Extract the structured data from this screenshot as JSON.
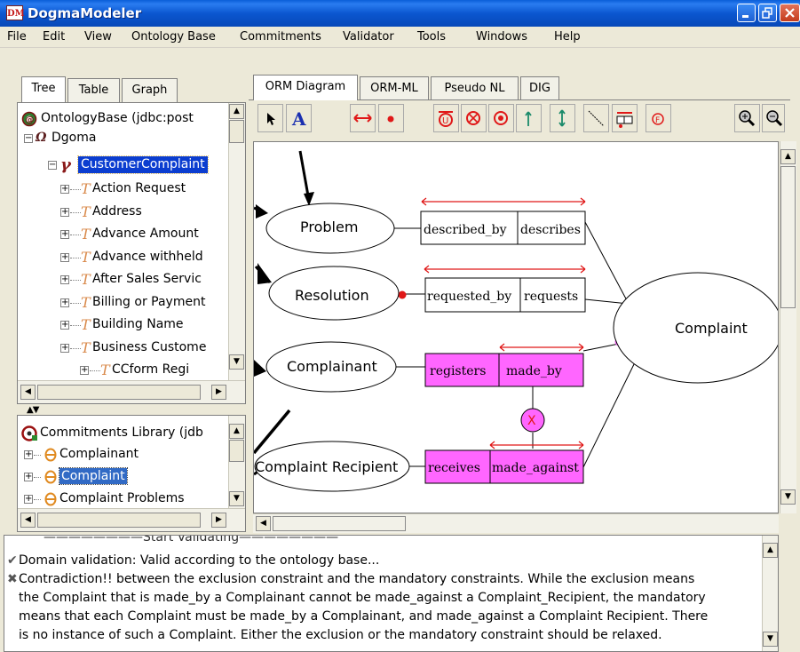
{
  "window": {
    "title": "DogmaModeler",
    "icon_label": "DM"
  },
  "menu": [
    "File",
    "Edit",
    "View",
    "Ontology Base",
    "Commitments",
    "Validator",
    "Tools",
    "Windows",
    "Help"
  ],
  "left_tabs": [
    "Tree",
    "Table",
    "Graph"
  ],
  "ontology_tree": {
    "root": "OntologyBase (jdbc:post",
    "child": "Dgoma",
    "selected": "CustomerComplaint",
    "items": [
      "Action Request",
      "Address",
      "Advance Amount",
      "Advance withheld",
      "After Sales Servic",
      "Billing or Payment",
      "Building Name",
      "Business Custome",
      "CCform Regi"
    ]
  },
  "commitments_tree": {
    "root": "Commitments Library (jdb",
    "items": [
      "Complainant",
      "Complaint",
      "Complaint Problems"
    ],
    "selected": "Complaint"
  },
  "editor_tabs": [
    "ORM Diagram",
    "ORM-ML",
    "Pseudo NL",
    "DIG"
  ],
  "toolbar_icons": [
    "pointer-icon",
    "text-icon",
    "double-arrow-icon",
    "mandatory-dot-icon",
    "uniqueness-icon",
    "exclusion-icon",
    "total-icon",
    "subtype-arrow-icon",
    "double-subtype-icon",
    "line-icon",
    "fact-type-icon",
    "frequency-icon",
    "zoom-in-icon",
    "zoom-out-icon"
  ],
  "diagram": {
    "objects": [
      "Problem",
      "Resolution",
      "Complainant",
      "Complaint Recipient",
      "Complaint"
    ],
    "roles": [
      {
        "left": "described_by",
        "right": "describes"
      },
      {
        "left": "requested_by",
        "right": "requests"
      },
      {
        "left": "registers",
        "right": "made_by"
      },
      {
        "left": "receives",
        "right": "made_against"
      }
    ],
    "exclusion_label": "X",
    "colors": {
      "highlight": "#ff66ff",
      "constraint": "#ff0000",
      "mandatory_pink": "#ee66ee"
    }
  },
  "log": {
    "header": "————————Start Validating————————",
    "lines": [
      {
        "icon": "check-icon",
        "text": "Domain validation: Valid according to the ontology base..."
      },
      {
        "icon": "cross-icon",
        "text": "Contradiction!! between the exclusion constraint and the mandatory constraints.  While the exclusion means"
      },
      {
        "icon": "",
        "text": "the Complaint that is made_by a Complainant cannot be made_against a Complaint_Recipient, the mandatory"
      },
      {
        "icon": "",
        "text": "means that each Complaint must be made_by a Complainant, and made_against a Complaint Recipient. There"
      },
      {
        "icon": "",
        "text": "is no instance of such a Complaint. Either the exclusion or the mandatory constraint should be relaxed."
      }
    ]
  }
}
